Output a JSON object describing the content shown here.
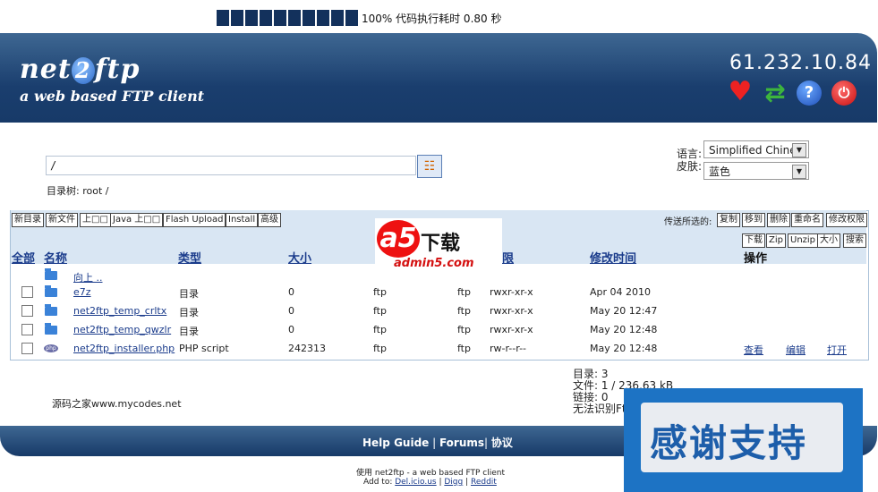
{
  "progress": {
    "text": "100% 代码执行耗时 0.80 秒",
    "fraction": 1.0
  },
  "header": {
    "logo_main_a": "net",
    "logo_main_b": "2",
    "logo_main_c": "ftp",
    "logo_sub": "a web based FTP client",
    "server_ip": "61.232.10.84",
    "icons": [
      "heart-icon",
      "refresh-icon",
      "help-icon",
      "logout-icon"
    ]
  },
  "path": {
    "value": "/",
    "dir_tree_label": "目录树: root /"
  },
  "settings": {
    "language_label": "语言:",
    "language_value": "Simplified Chine:",
    "skin_label": "皮肤:",
    "skin_value": "蓝色"
  },
  "toolbar": {
    "left_buttons": [
      "新目录",
      "新文件",
      "上□□",
      "Java 上□□",
      "Flash Upload",
      "Install",
      "高级"
    ],
    "actions_label": "传送所选的:",
    "right_buttons_1": [
      "复制",
      "移到",
      "删除",
      "重命名",
      "修改权限"
    ],
    "right_buttons_2": [
      "下载",
      "Zip",
      "Unzip",
      "大小",
      "搜索"
    ]
  },
  "table": {
    "headers": {
      "all": "全部",
      "name": "名称",
      "type": "类型",
      "size": "大小",
      "perm": "限",
      "mtime": "修改时间",
      "actions": "操作"
    },
    "up": "向上 ..",
    "rows": [
      {
        "name": "e7z",
        "type": "目录",
        "size": "0",
        "owner": "ftp",
        "group": "ftp",
        "perms": "rwxr-xr-x",
        "mtime": "Apr 04 2010",
        "kind": "folder"
      },
      {
        "name": "net2ftp_temp_crltx",
        "type": "目录",
        "size": "0",
        "owner": "ftp",
        "group": "ftp",
        "perms": "rwxr-xr-x",
        "mtime": "May 20 12:47",
        "kind": "folder"
      },
      {
        "name": "net2ftp_temp_qwzlr",
        "type": "目录",
        "size": "0",
        "owner": "ftp",
        "group": "ftp",
        "perms": "rwxr-xr-x",
        "mtime": "May 20 12:48",
        "kind": "folder"
      },
      {
        "name": "net2ftp_installer.php",
        "type": "PHP script",
        "size": "242313",
        "owner": "ftp",
        "group": "ftp",
        "perms": "rw-r--r--",
        "mtime": "May 20 12:48",
        "kind": "php"
      }
    ],
    "row_actions": [
      "查看",
      "编辑",
      "打开"
    ]
  },
  "stats": {
    "dirs": "目录: 3",
    "files": "文件: 1 / 236.63 kB",
    "links": "链接: 0",
    "unknown": "无法识别Ft"
  },
  "mycodes": "源码之家www.mycodes.net",
  "footer": {
    "help": "Help Guide",
    "sep1": " | ",
    "forums": "Forums",
    "sep2": "| ",
    "protocol": "协议"
  },
  "powered": "使用 net2ftp - a web based FTP client",
  "addto": {
    "label": "Add to: ",
    "delicious": "Del.icio.us",
    "sep1": " | ",
    "digg": "Digg",
    "sep2": " | ",
    "reddit": "Reddit"
  },
  "watermarks": {
    "a5_mark": "a5",
    "a5_text": "下载",
    "a5_domain": "admin5.com",
    "thanks": "感谢支持"
  },
  "colors": {
    "header": "#1a3e6e",
    "panel": "#d9e6f3",
    "link": "#1a3b8b",
    "accent_red": "#e11111"
  }
}
